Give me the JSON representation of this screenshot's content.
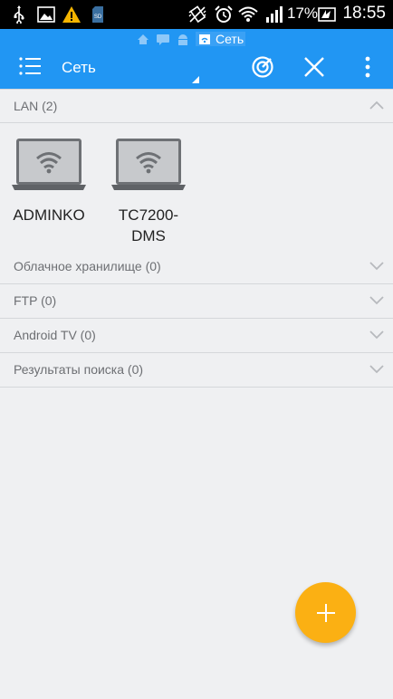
{
  "status_bar": {
    "icons": [
      "usb-icon",
      "image-icon",
      "warning-icon",
      "sd-card-icon",
      "vibrate-icon",
      "alarm-icon",
      "wifi-icon",
      "signal-icon"
    ],
    "battery_percent": "17%",
    "time": "18:55",
    "sd_label": "SD"
  },
  "toolbar": {
    "breadcrumb_current": "Сеть",
    "title": "Сеть",
    "color": "#2196f3"
  },
  "sections": {
    "lan": {
      "label": "LAN (2)",
      "expanded": true
    },
    "cloud": {
      "label": "Облачное хранилище (0)",
      "expanded": false
    },
    "ftp": {
      "label": "FTP (0)",
      "expanded": false
    },
    "android_tv": {
      "label": "Android TV (0)",
      "expanded": false
    },
    "search": {
      "label": "Результаты поиска (0)",
      "expanded": false
    }
  },
  "devices": [
    {
      "name": "ADMINKO"
    },
    {
      "name": "TC7200-DMS"
    }
  ],
  "fab": {
    "icon": "plus-icon",
    "color": "#fbb013"
  }
}
